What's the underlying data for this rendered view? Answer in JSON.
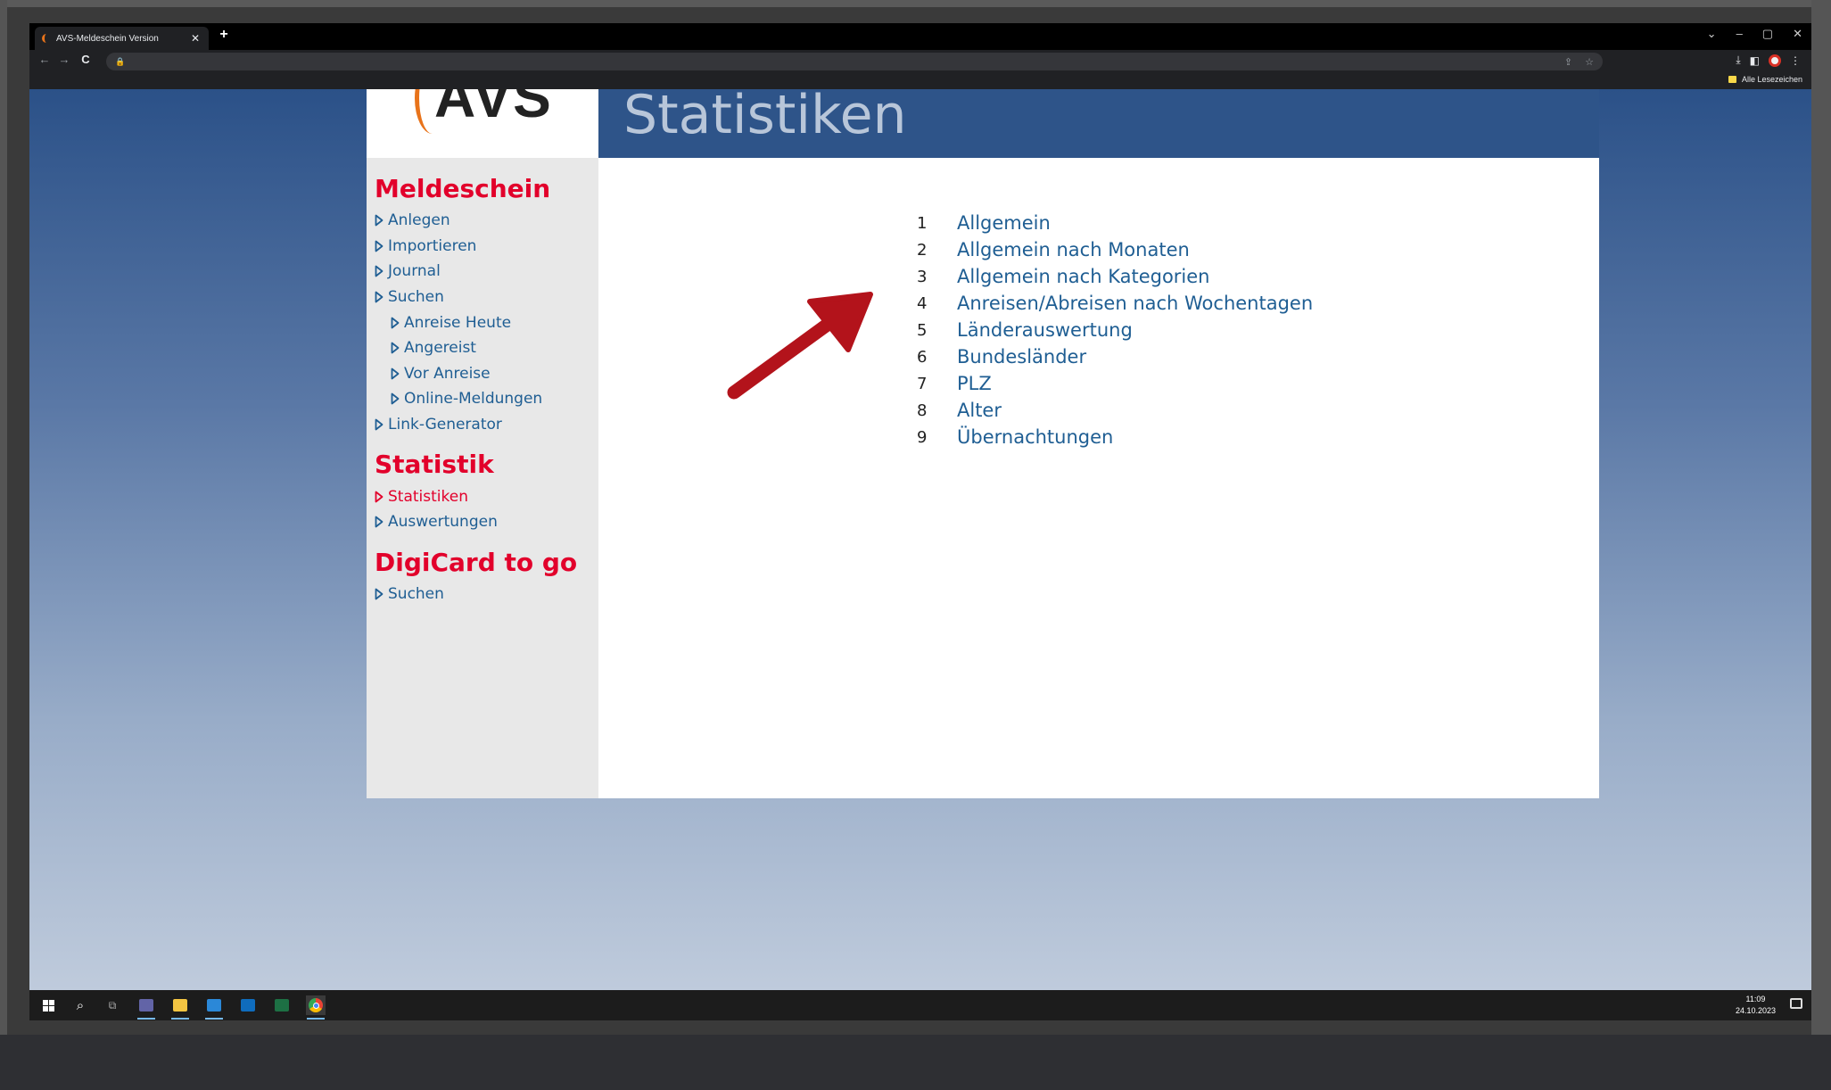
{
  "browser": {
    "tab_title": "AVS-Meldeschein Version",
    "tab_close": "✕",
    "new_tab": "+",
    "window_controls": [
      "⌄",
      "–",
      "▢",
      "✕"
    ],
    "nav": {
      "back": "←",
      "forward": "→",
      "reload": "C",
      "lock": "🔒"
    },
    "omni_actions": [
      "⇪",
      "☆"
    ],
    "tools": {
      "download": "⤓",
      "sidepanel": "◧",
      "menu": "⋮"
    },
    "bookmarks_label": "Alle Lesezeichen"
  },
  "page": {
    "logo_text": "AVS",
    "title": "Statistiken"
  },
  "sidebar": {
    "sections": [
      {
        "heading": "Meldeschein",
        "links": [
          {
            "label": "Anlegen",
            "sub": false,
            "active": false
          },
          {
            "label": "Importieren",
            "sub": false,
            "active": false
          },
          {
            "label": "Journal",
            "sub": false,
            "active": false
          },
          {
            "label": "Suchen",
            "sub": false,
            "active": false
          },
          {
            "label": "Anreise Heute",
            "sub": true,
            "active": false
          },
          {
            "label": "Angereist",
            "sub": true,
            "active": false
          },
          {
            "label": "Vor Anreise",
            "sub": true,
            "active": false
          },
          {
            "label": "Online-Meldungen",
            "sub": true,
            "active": false
          },
          {
            "label": "Link-Generator",
            "sub": false,
            "active": false
          }
        ]
      },
      {
        "heading": "Statistik",
        "links": [
          {
            "label": "Statistiken",
            "sub": false,
            "active": true
          },
          {
            "label": "Auswertungen",
            "sub": false,
            "active": false
          }
        ]
      },
      {
        "heading": "DigiCard to go",
        "links": [
          {
            "label": "Suchen",
            "sub": false,
            "active": false
          }
        ]
      }
    ]
  },
  "statistics": [
    {
      "num": "1",
      "label": "Allgemein"
    },
    {
      "num": "2",
      "label": "Allgemein nach Monaten"
    },
    {
      "num": "3",
      "label": "Allgemein nach Kategorien"
    },
    {
      "num": "4",
      "label": "Anreisen/Abreisen nach Wochentagen"
    },
    {
      "num": "5",
      "label": "Länderauswertung"
    },
    {
      "num": "6",
      "label": "Bundesländer"
    },
    {
      "num": "7",
      "label": "PLZ"
    },
    {
      "num": "8",
      "label": "Alter"
    },
    {
      "num": "9",
      "label": "Übernachtungen"
    }
  ],
  "taskbar": {
    "time": "11:09",
    "date": "24.10.2023"
  },
  "colors": {
    "accent_red": "#e2002b",
    "link_blue": "#1f5e93",
    "header_blue": "#2e5489",
    "arrow_red": "#b3131b"
  }
}
